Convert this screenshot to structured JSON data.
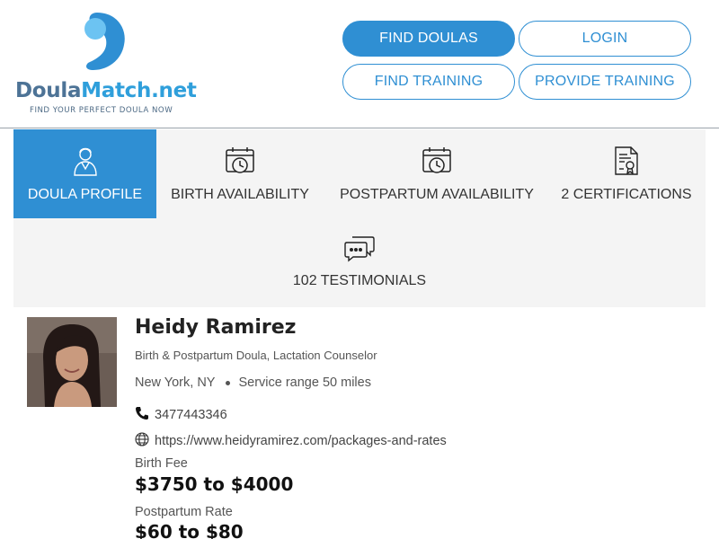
{
  "brand": {
    "name_part1": "Doula",
    "name_part2": "Match.net",
    "tagline": "FIND YOUR PERFECT DOULA NOW",
    "colors": {
      "primary": "#2f8fd3",
      "dark": "#4d7396",
      "light": "#6cc3f2"
    }
  },
  "nav": {
    "find_doulas": "FIND DOULAS",
    "login": "LOGIN",
    "find_training": "FIND TRAINING",
    "provide_training": "PROVIDE TRAINING"
  },
  "tabs": [
    {
      "label": "DOULA PROFILE",
      "icon": "person-icon",
      "active": true
    },
    {
      "label": "BIRTH AVAILABILITY",
      "icon": "calendar-clock-icon",
      "active": false
    },
    {
      "label": "POSTPARTUM AVAILABILITY",
      "icon": "calendar-clock-icon",
      "active": false
    },
    {
      "label": "2 CERTIFICATIONS",
      "icon": "certificate-icon",
      "active": false
    },
    {
      "label": "102 TESTIMONIALS",
      "icon": "chat-bubbles-icon",
      "active": false
    }
  ],
  "profile": {
    "name": "Heidy Ramirez",
    "title": "Birth & Postpartum Doula, Lactation Counselor",
    "location": "New York, NY",
    "service_range": "Service range 50 miles",
    "phone": "3477443346",
    "website": "https://www.heidyramirez.com/packages-and-rates",
    "birth_fee_label": "Birth Fee",
    "birth_fee": "$3750 to $4000",
    "postpartum_rate_label": "Postpartum Rate",
    "postpartum_rate": "$60 to $80"
  }
}
